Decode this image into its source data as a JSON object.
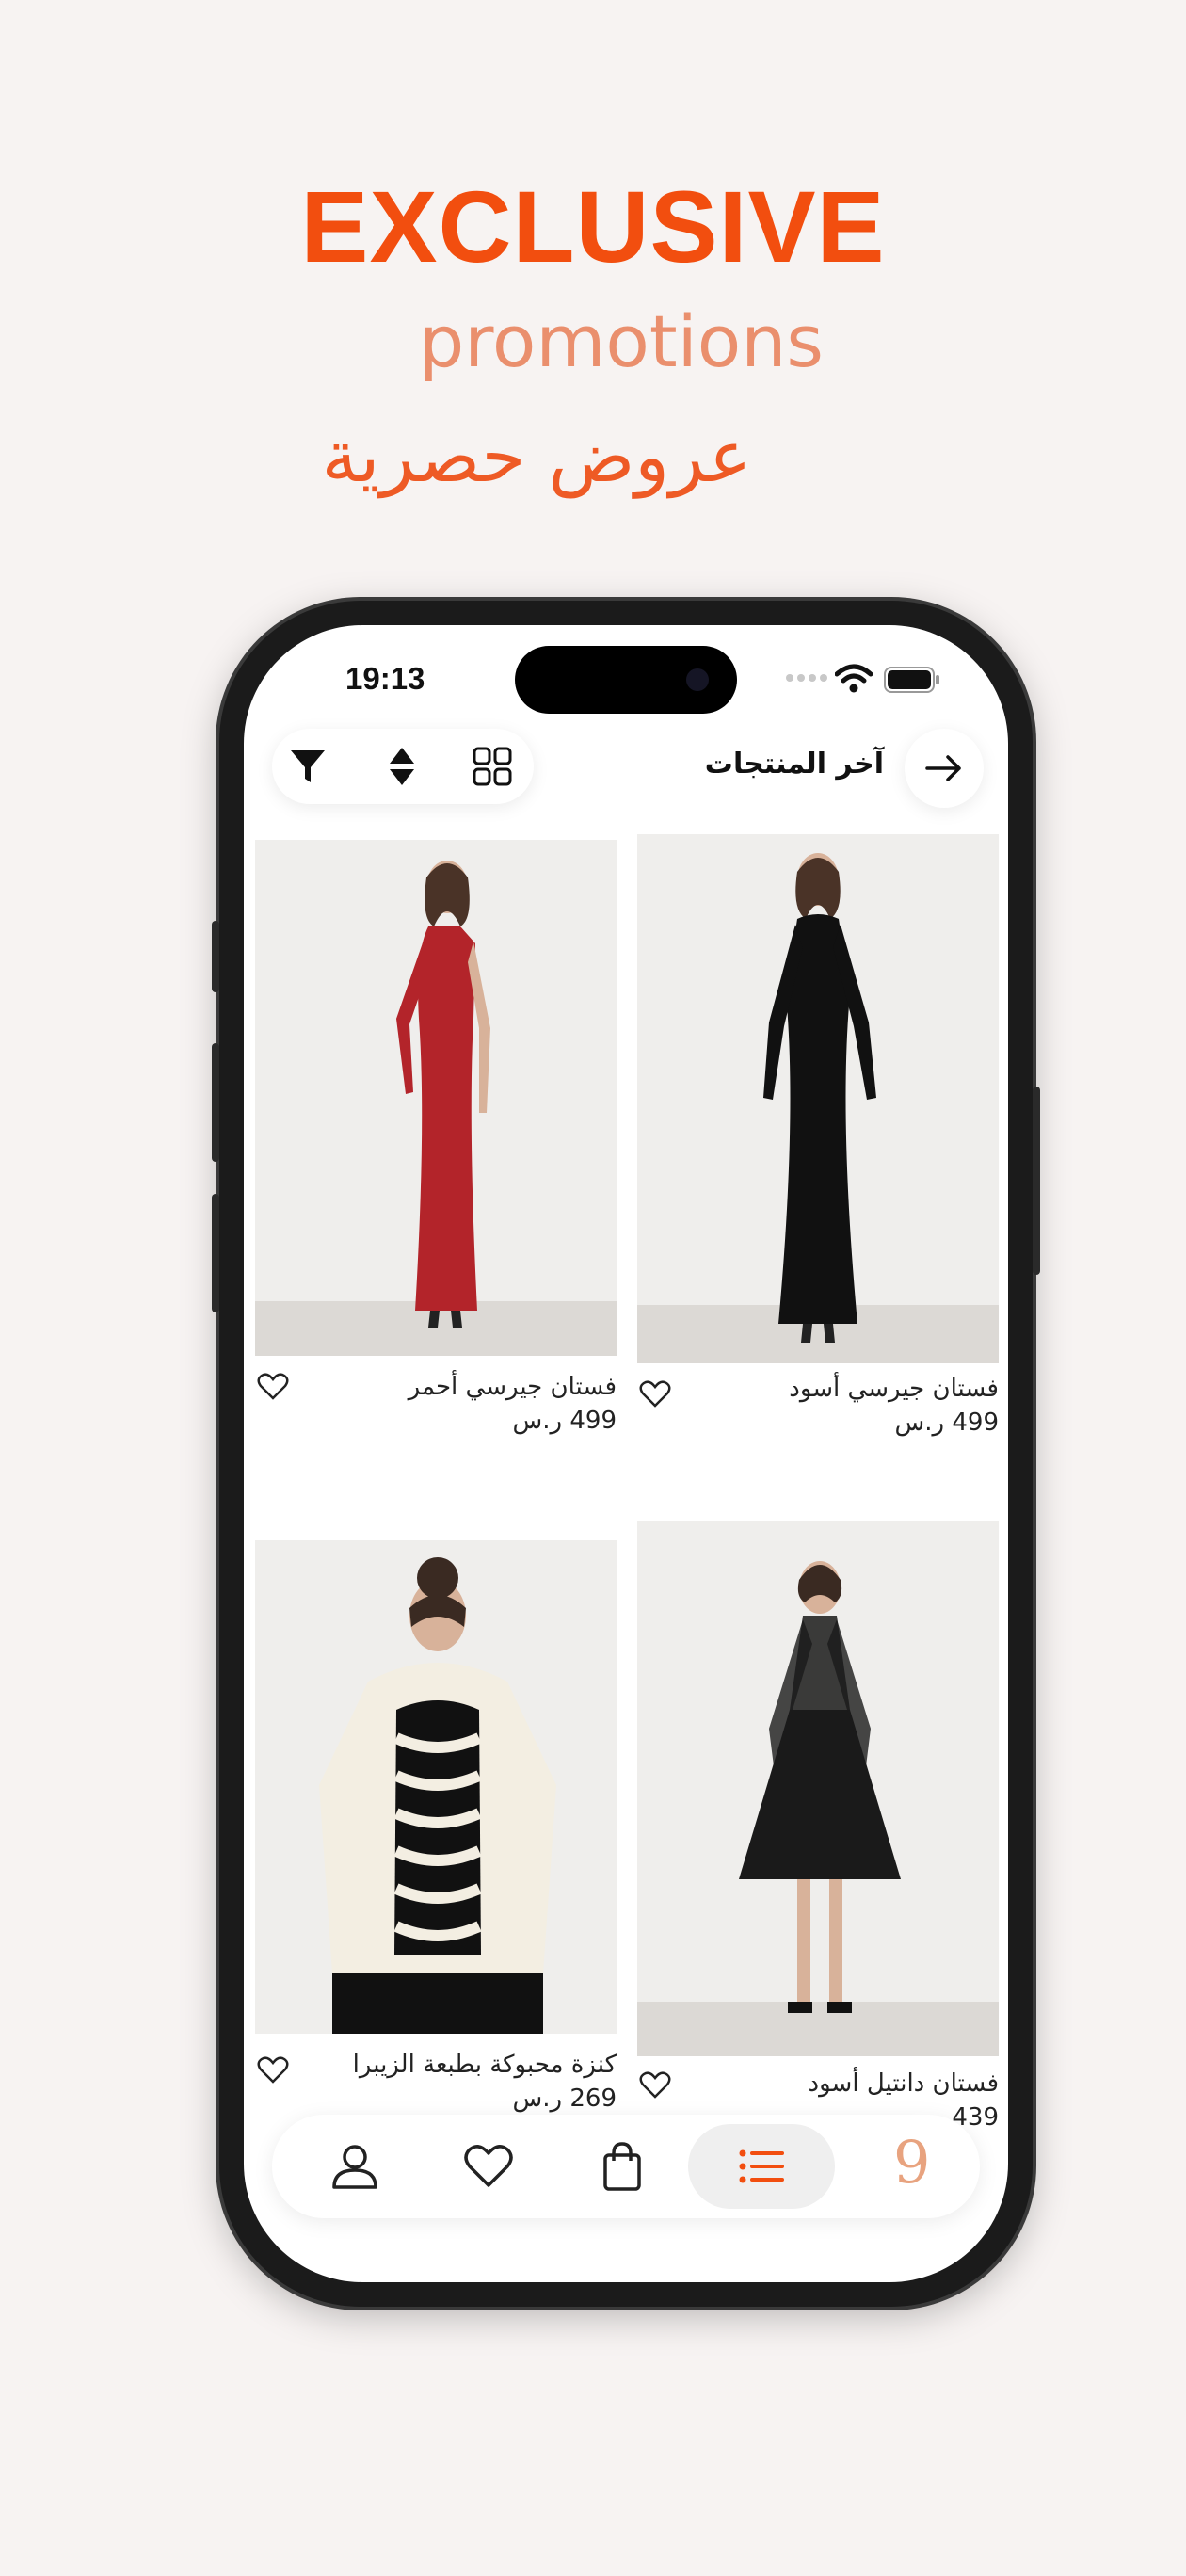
{
  "hero": {
    "title": "EXCLUSIVE",
    "subtitle": "promotions",
    "arabic": "عروض حصرية"
  },
  "status_bar": {
    "time": "19:13"
  },
  "header": {
    "title": "آخر المنتجات"
  },
  "toolbar": {
    "icons": [
      "filter-icon",
      "sort-icon",
      "grid-view-icon"
    ]
  },
  "products": [
    {
      "name": "فستان جيرسي أسود",
      "price": "499 ر.س",
      "color": "#111111"
    },
    {
      "name": "فستان جيرسي أحمر",
      "price": "499 ر.س",
      "color": "#b3242a"
    },
    {
      "name": "فستان دانتيل أسود",
      "price": "439 ر.س",
      "color": "#1a1a1a"
    },
    {
      "name": "كنزة  محبوكة بطبعة الزيبرا",
      "price": "269 ر.س",
      "color": "#f3eee2"
    }
  ],
  "bottom_nav": {
    "items": [
      "profile-icon",
      "wishlist-icon",
      "cart-icon",
      "categories-icon"
    ],
    "active": "categories-icon",
    "brand": "9"
  },
  "colors": {
    "accent": "#f24e0f",
    "accent_light": "#ea8f6d",
    "background": "#f7f3f2"
  }
}
